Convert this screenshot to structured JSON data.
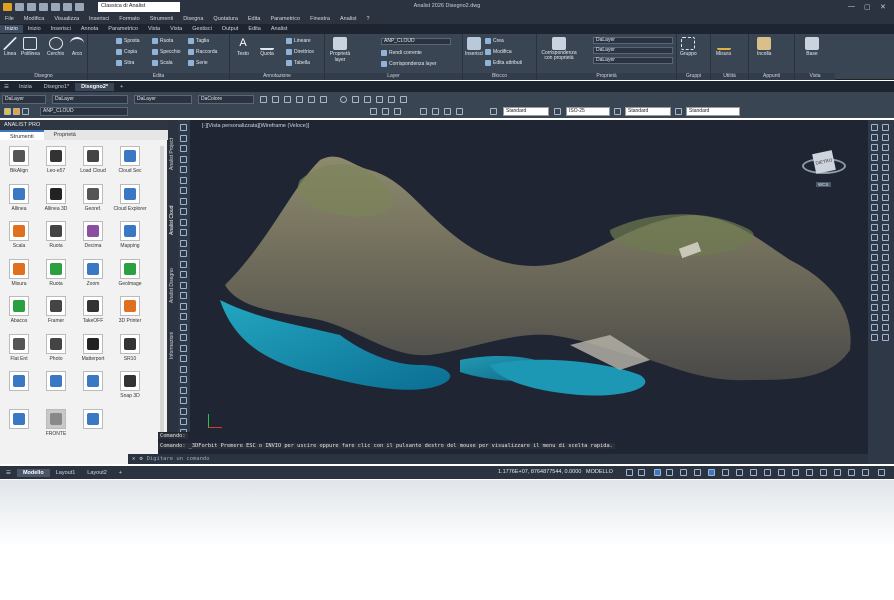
{
  "titlebar": {
    "workspace": "Classica di Analist",
    "app_title": "Analist 2026  Disegno2.dwg",
    "min": "—",
    "max": "▢",
    "close": "✕"
  },
  "menu": [
    "File",
    "Modifica",
    "Visualizza",
    "Inserisci",
    "Formato",
    "Strumenti",
    "Disegna",
    "Quotatura",
    "Edita",
    "Parametrico",
    "Finestra",
    "Analist",
    "?"
  ],
  "ribbon_tabs": [
    "Inizio",
    "Inizio",
    "Inserisci",
    "Annota",
    "Parametrico",
    "Vista",
    "Vista",
    "Gestisci",
    "Output",
    "Edita",
    "Analist"
  ],
  "ribbon": {
    "disegno": {
      "label": "Disegno",
      "linea": "Linea",
      "polilinea": "Polilinea",
      "cerchio": "Cerchio",
      "arco": "Arco"
    },
    "edita": {
      "label": "Edita",
      "sposta": "Sposta",
      "ruota": "Ruota",
      "taglia": "Taglia",
      "copia": "Copia",
      "specchio": "Specchio",
      "raccorda": "Raccorda",
      "stira": "Stira",
      "scala": "Scala",
      "serie": "Serie"
    },
    "annotazione": {
      "label": "Annotazione",
      "testo": "Testo",
      "quota": "Quota",
      "lineare": "Lineare",
      "direttrice": "Direttrice",
      "tabella": "Tabella"
    },
    "layer": {
      "label": "Layer",
      "proprieta_layer": "Proprietà layer",
      "current_layer": "ANP_CLOUD",
      "rendi_corrente": "Rendi corrente",
      "corrispondenza_layer": "Corrispondenza layer"
    },
    "blocco": {
      "label": "Blocco",
      "inserisci": "Inserisci",
      "crea": "Crea",
      "modifica": "Modifica",
      "edita_attributi": "Edita attributi"
    },
    "proprieta": {
      "label": "Proprietà",
      "corrispondenza": "Corrispondenza con proprietà",
      "color": "DaLayer",
      "linetype": "DaLayer",
      "lineweight": "DaLayer"
    },
    "gruppi": {
      "label": "Gruppi",
      "gruppo": "Gruppo"
    },
    "utilita": {
      "label": "Utilità",
      "misura": "Misura"
    },
    "appunti": {
      "label": "Appunti",
      "incolla": "Incolla"
    },
    "vista": {
      "label": "Vista",
      "base": "Base"
    }
  },
  "doc_tabs": [
    "Inizia",
    "Disegno1*",
    "Disegno2*",
    "+"
  ],
  "props_toolbar": {
    "layer": "DaLayer",
    "linetype": "DaLayer",
    "lineweight": "DaLayer",
    "color": "DaColore",
    "current_layer": "ANP_CLOUD",
    "text_style": "Standard",
    "dim_style": "ISO-25",
    "table_style": "Standard",
    "mleader_style": "Standard"
  },
  "left_panel": {
    "title": "ANALIST PRO",
    "tabs": [
      "Strumenti",
      "Proprietà"
    ],
    "tools": [
      {
        "label": "BikAlign",
        "icon": "align-icon"
      },
      {
        "label": "Leo-e57",
        "icon": "e57-icon"
      },
      {
        "label": "Load Cloud",
        "icon": "load-cloud-icon"
      },
      {
        "label": "Cloud Sec",
        "icon": "cloud-section-icon"
      },
      {
        "label": "Allinea",
        "icon": "allinea-icon"
      },
      {
        "label": "Allinea 3D",
        "icon": "allinea3d-icon"
      },
      {
        "label": "Georef.",
        "icon": "georef-icon"
      },
      {
        "label": "Cloud Explorer",
        "icon": "cloud-explorer-icon"
      },
      {
        "label": "Scala",
        "icon": "scala-icon"
      },
      {
        "label": "Ruota",
        "icon": "ruota-icon"
      },
      {
        "label": "Decima",
        "icon": "decima-icon"
      },
      {
        "label": "Mapping",
        "icon": "mapping-icon"
      },
      {
        "label": "Misura",
        "icon": "misura-icon"
      },
      {
        "label": "Ruota",
        "icon": "ruota2-icon"
      },
      {
        "label": "Zoom",
        "icon": "zoom-icon"
      },
      {
        "label": "Geolmage",
        "icon": "geoimage-icon"
      },
      {
        "label": "Abacos",
        "icon": "abacos-icon"
      },
      {
        "label": "Framer",
        "icon": "framer-icon"
      },
      {
        "label": "TakeOFF",
        "icon": "takeoff-icon"
      },
      {
        "label": "3D Printer",
        "icon": "printer3d-icon"
      },
      {
        "label": "Flat Ent",
        "icon": "flat-icon"
      },
      {
        "label": "Photo",
        "icon": "photo-icon"
      },
      {
        "label": "Matterport",
        "icon": "matterport-icon"
      },
      {
        "label": "SR10",
        "icon": "sr10-icon"
      },
      {
        "label": "",
        "icon": "arrow-nw-icon"
      },
      {
        "label": "",
        "icon": "arrow-up-icon"
      },
      {
        "label": "",
        "icon": "arrow-ne-icon"
      },
      {
        "label": "Snap 3D",
        "icon": "snap3d-icon"
      },
      {
        "label": "",
        "icon": "arrow-left-icon"
      },
      {
        "label": "FRONTE",
        "icon": "front-view-icon"
      },
      {
        "label": "",
        "icon": "arrow-right-icon"
      }
    ]
  },
  "vertical_tabs": [
    "Analist Project",
    "Analist Cloud",
    "Analist Disegno",
    "Informazioni"
  ],
  "viewport": {
    "label": "[-][Vista personalizzata][Wireframe (Veloce)]",
    "viewcube_face": "DIETRO",
    "wcs": "WCS"
  },
  "command": {
    "line1": "Comando:",
    "line2": "Comando: _3DForbit Premere ESC o INVIO per uscire oppure fare clic con il pulsante destro del mouse per visualizzare il menu di scelta rapida.",
    "input_placeholder": "Digitare un comando"
  },
  "status": {
    "tabs": [
      "Modello",
      "Layout1",
      "Layout2",
      "+"
    ],
    "coords": "1.1776E+07, 8764877544, 0.0000",
    "mode": "MODELLO"
  }
}
